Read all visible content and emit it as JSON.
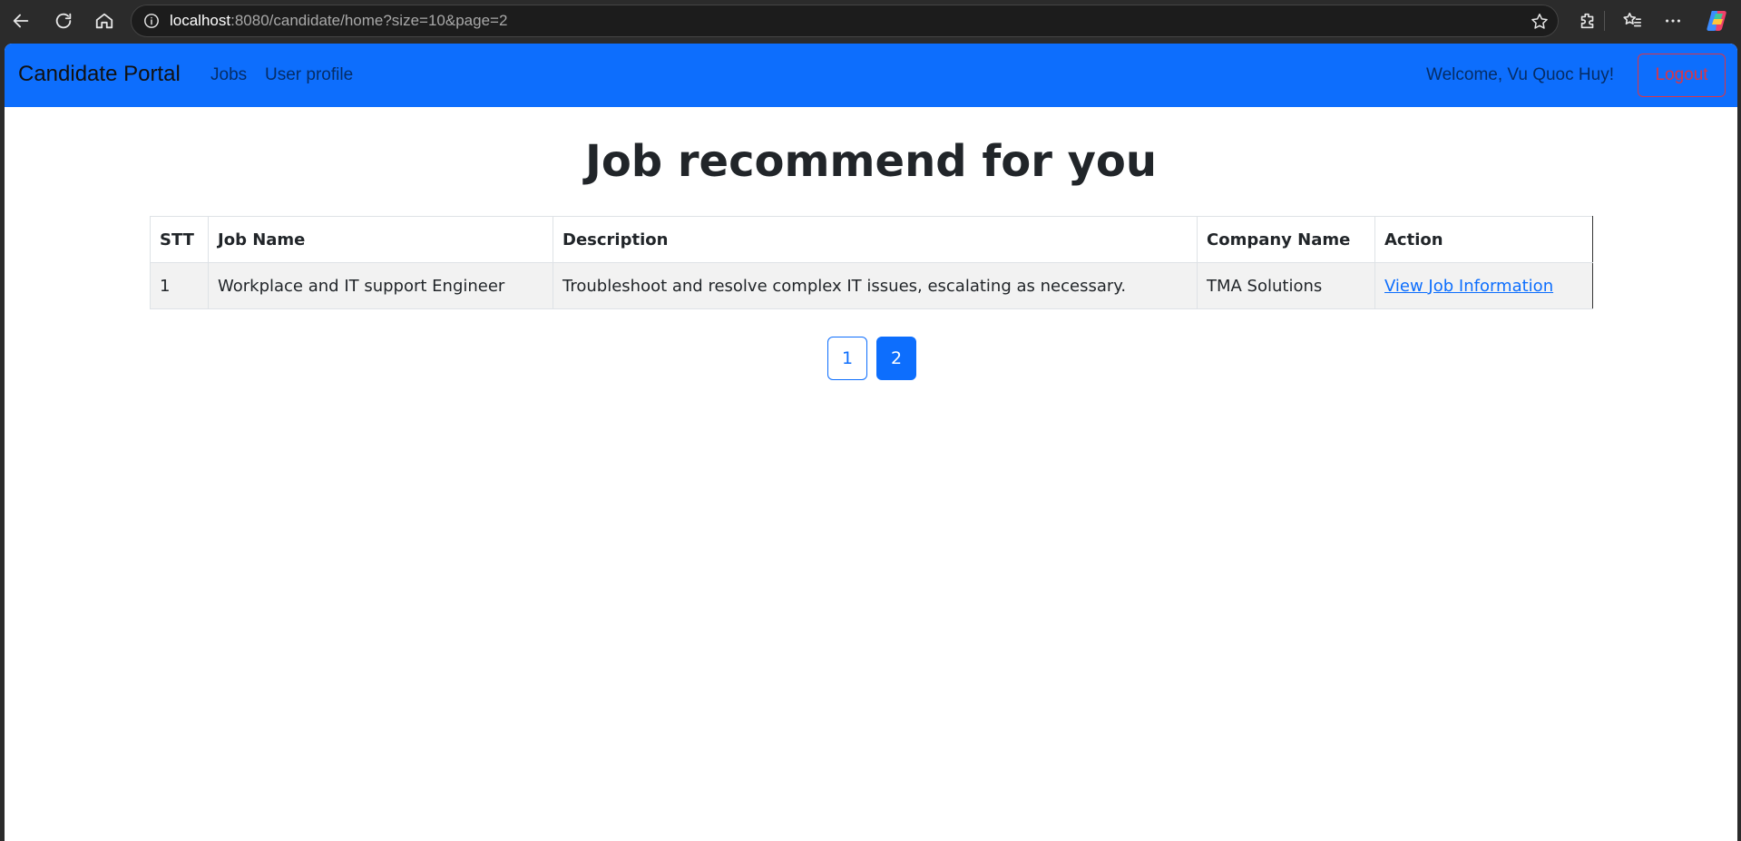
{
  "browser": {
    "url_host": "localhost",
    "url_rest": ":8080/candidate/home?size=10&page=2"
  },
  "navbar": {
    "brand": "Candidate Portal",
    "links": [
      "Jobs",
      "User profile"
    ],
    "welcome": "Welcome, Vu Quoc Huy!",
    "logout_label": "Logout"
  },
  "page": {
    "title": "Job recommend for you"
  },
  "table": {
    "headers": [
      "STT",
      "Job Name",
      "Description",
      "Company Name",
      "Action"
    ],
    "rows": [
      {
        "stt": "1",
        "job_name": "Workplace and IT support Engineer",
        "description": "Troubleshoot and resolve complex IT issues, escalating as necessary.",
        "company": "TMA Solutions",
        "action": "View Job Information"
      }
    ]
  },
  "pagination": {
    "pages": [
      "1",
      "2"
    ],
    "current": "2"
  },
  "colors": {
    "primary": "#0d6efd",
    "danger": "#dc3545",
    "text": "#212529"
  }
}
